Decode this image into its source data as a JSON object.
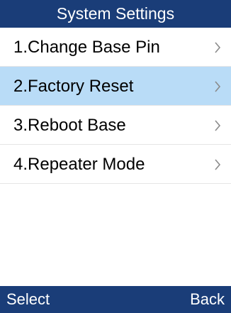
{
  "header": {
    "title": "System Settings"
  },
  "menu": {
    "selected_index": 1,
    "items": [
      {
        "label": "1.Change Base Pin",
        "icon": "chevron-right-icon"
      },
      {
        "label": "2.Factory Reset",
        "icon": "chevron-right-icon"
      },
      {
        "label": "3.Reboot Base",
        "icon": "chevron-right-icon"
      },
      {
        "label": "4.Repeater Mode",
        "icon": "chevron-right-icon"
      }
    ]
  },
  "softkeys": {
    "left_label": "Select",
    "right_label": "Back"
  },
  "colors": {
    "bar_background": "#1a3d78",
    "selected_row": "#b9dcf7",
    "chevron": "#8a8a8a"
  }
}
